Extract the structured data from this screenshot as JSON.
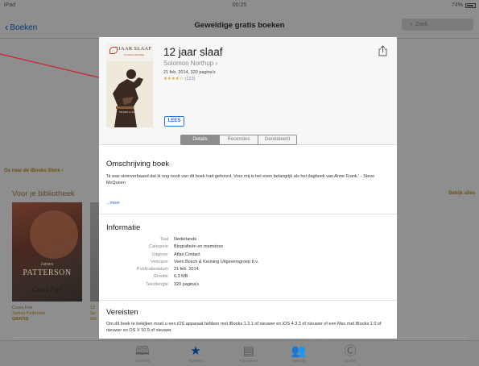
{
  "status_bar": {
    "device": "iPad",
    "time": "00:25",
    "battery": "74%"
  },
  "nav": {
    "back_label": "Boeken",
    "title": "Geweldige gratis boeken",
    "search_placeholder": "Zoek"
  },
  "background": {
    "store_link": "Ga naar de iBooks Store ›",
    "section_title": "Voor je bibliotheek",
    "see_all": "Bekijk alles",
    "book": {
      "cover_author": "James",
      "cover_name": "PATTERSON",
      "cover_title": "Cross Fire",
      "title": "Cross Fire",
      "author": "James Patterson",
      "price": "GRATIS"
    },
    "book2": {
      "line1": "12",
      "line2": "So",
      "line3": "GR"
    }
  },
  "tabbar": {
    "items": [
      {
        "icon": "open-book-icon",
        "label": "Uitgelicht"
      },
      {
        "icon": "star-icon",
        "label": "Toplijsten"
      },
      {
        "icon": "list-icon",
        "label": "Top-auteurs"
      },
      {
        "icon": "people-icon",
        "label": "Gekocht"
      },
      {
        "icon": "compass-icon",
        "label": "Ontdek"
      }
    ]
  },
  "modal": {
    "cover_title": "JAAR SLAAF",
    "cover_author": "Solomon Northup",
    "title": "12 jaar slaaf",
    "author": "Solomon Northup ›",
    "date_pages": "21 feb. 2014, 320 pagina's",
    "rating_stars": "★★★★☆",
    "rating_count": "(123)",
    "read_button": "LEES",
    "tabs": [
      "Details",
      "Recensies",
      "Gerelateerd"
    ],
    "active_tab": 0,
    "description": {
      "title": "Omschrijving boek",
      "text": "'Ik was stomverbaasd dat ik nog nooit van dit boek had gehoord. Voor mij is het even belangrijk als het dagboek van Anne Frank.' - Steve McQueen",
      "more": "...meer"
    },
    "info": {
      "title": "Informatie",
      "rows": [
        {
          "label": "Taal",
          "value": "Nederlands"
        },
        {
          "label": "Categorie",
          "value": "Biografieën en memoires"
        },
        {
          "label": "Uitgever",
          "value": "Atlas Contact"
        },
        {
          "label": "Verkoper",
          "value": "Veen Bosch & Keuning Uitgeversgroep b.v."
        },
        {
          "label": "Publicatiedatum",
          "value": "21 feb. 2014"
        },
        {
          "label": "Grootte",
          "value": "6,3 MB"
        },
        {
          "label": "Tekstlengte",
          "value": "320 pagina's"
        }
      ]
    },
    "requirements": {
      "title": "Vereisten",
      "text": "Om dit boek te bekijken moet u een iOS apparaat hebben met iBooks 1.3.1 of nieuwer en iOS 4.3.3 of nieuwer of een Mac met iBooks 1.0 of nieuwer en OS X 10.9 of nieuwer."
    }
  },
  "colors": {
    "accent": "#1e6ad0",
    "dim_overlay": "#8e8e8e",
    "annotation": "#cc2233"
  }
}
